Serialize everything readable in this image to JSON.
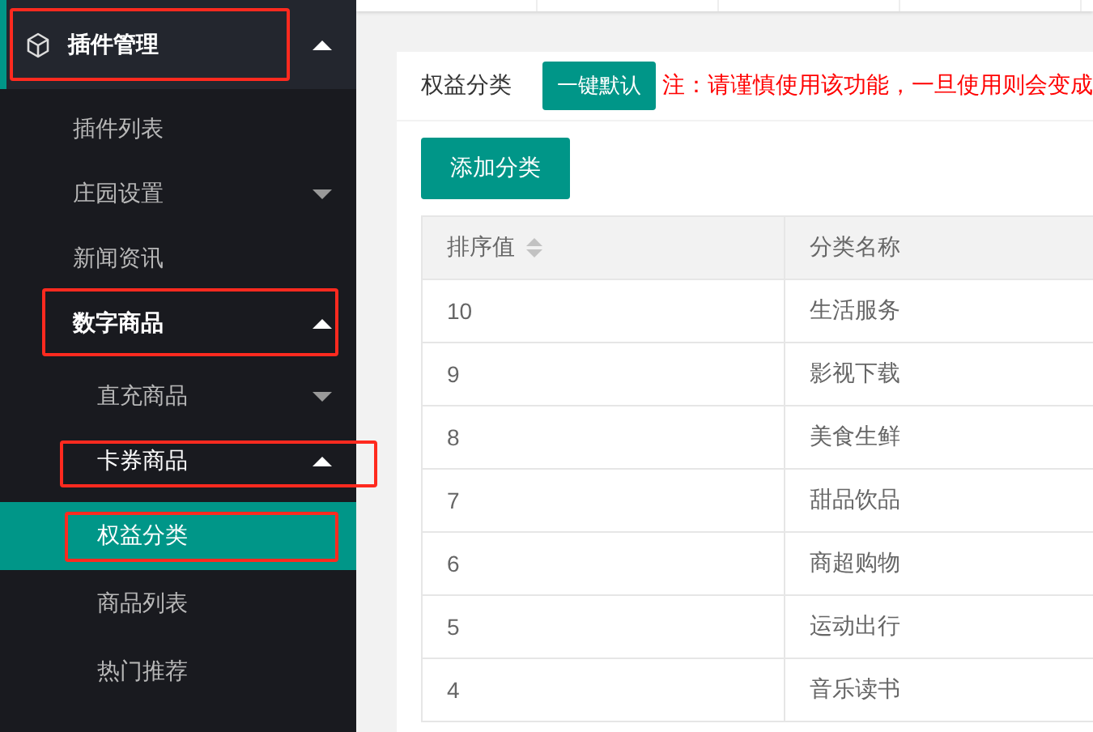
{
  "sidebar": {
    "menu": [
      {
        "label": "插件管理",
        "expanded": true,
        "selected": false,
        "highlighted": true,
        "children": [
          {
            "label": "插件列表",
            "selected": false,
            "highlighted": false
          },
          {
            "label": "庄园设置",
            "expanded": false,
            "selected": false,
            "highlighted": false
          },
          {
            "label": "新闻资讯",
            "selected": false,
            "highlighted": false
          },
          {
            "label": "数字商品",
            "expanded": true,
            "selected": false,
            "highlighted": true,
            "children": [
              {
                "label": "直充商品",
                "expanded": false,
                "selected": false,
                "highlighted": false
              },
              {
                "label": "卡券商品",
                "expanded": true,
                "selected": false,
                "highlighted": true,
                "children": [
                  {
                    "label": "权益分类",
                    "selected": true,
                    "highlighted": true
                  },
                  {
                    "label": "商品列表",
                    "selected": false,
                    "highlighted": false
                  },
                  {
                    "label": "热门推荐",
                    "selected": false,
                    "highlighted": false
                  }
                ]
              }
            ]
          }
        ]
      }
    ]
  },
  "card": {
    "title": "权益分类",
    "default_button": "一键默认",
    "warning": "注：请谨慎使用该功能，一旦使用则会变成",
    "add_button": "添加分类"
  },
  "table": {
    "columns": [
      {
        "label": "排序值",
        "sortable": true
      },
      {
        "label": "分类名称",
        "sortable": false
      }
    ],
    "rows": [
      [
        "10",
        "生活服务"
      ],
      [
        "9",
        "影视下载"
      ],
      [
        "8",
        "美食生鲜"
      ],
      [
        "7",
        "甜品饮品"
      ],
      [
        "6",
        "商超购物"
      ],
      [
        "5",
        "运动出行"
      ],
      [
        "4",
        "音乐读书"
      ]
    ]
  }
}
